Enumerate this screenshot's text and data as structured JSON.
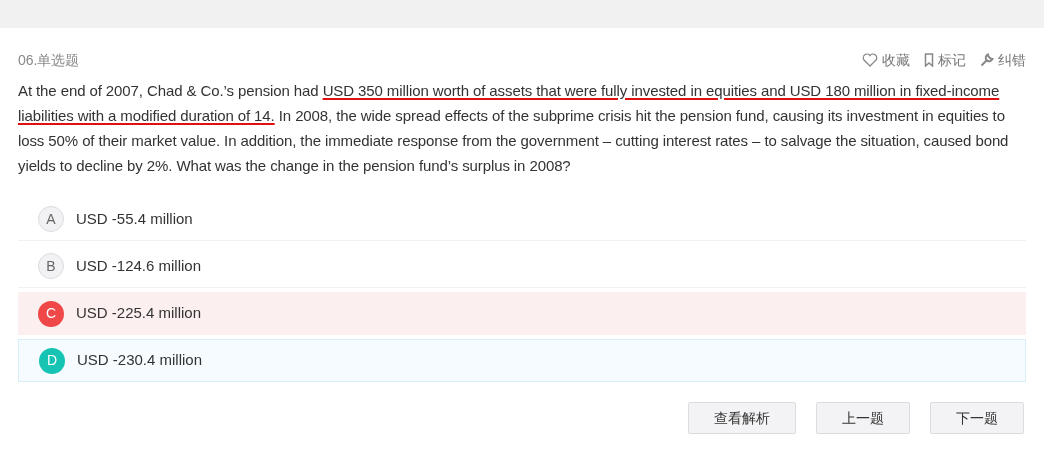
{
  "question": {
    "number": "06.单选题",
    "actions": [
      {
        "kind": "heart",
        "label": "收藏"
      },
      {
        "kind": "bookmark",
        "label": "标记"
      },
      {
        "kind": "wrench",
        "label": "纠错"
      }
    ],
    "text": [
      {
        "text": "At the end of 2007, Chad & Co.’s pension had ",
        "underlined": false
      },
      {
        "text": "USD 350 million worth of assets that were fully invested in equities and USD 180 million in fixed-income liabilities with a modified duration of 14.",
        "underlined": true
      },
      {
        "text": " In 2008, the wide spread effects of the subprime crisis hit the pension fund, causing its investment in equities to loss 50% of their market value. In addition, the immediate response from the government – cutting interest rates – to salvage the situation, caused bond yields to decline by 2%. What was the change in the pension fund’s surplus in 2008?",
        "underlined": false
      }
    ]
  },
  "options": [
    {
      "letter": "A",
      "text": "USD -55.4 million",
      "selected": false,
      "correct": false
    },
    {
      "letter": "B",
      "text": "USD -124.6 million",
      "selected": false,
      "correct": false
    },
    {
      "letter": "C",
      "text": "USD -225.4 million",
      "selected": true,
      "correct": false
    },
    {
      "letter": "D",
      "text": "USD -230.4 million",
      "selected": false,
      "correct": true
    }
  ],
  "buttons": [
    "查看解析",
    "上一题",
    "下一题"
  ]
}
